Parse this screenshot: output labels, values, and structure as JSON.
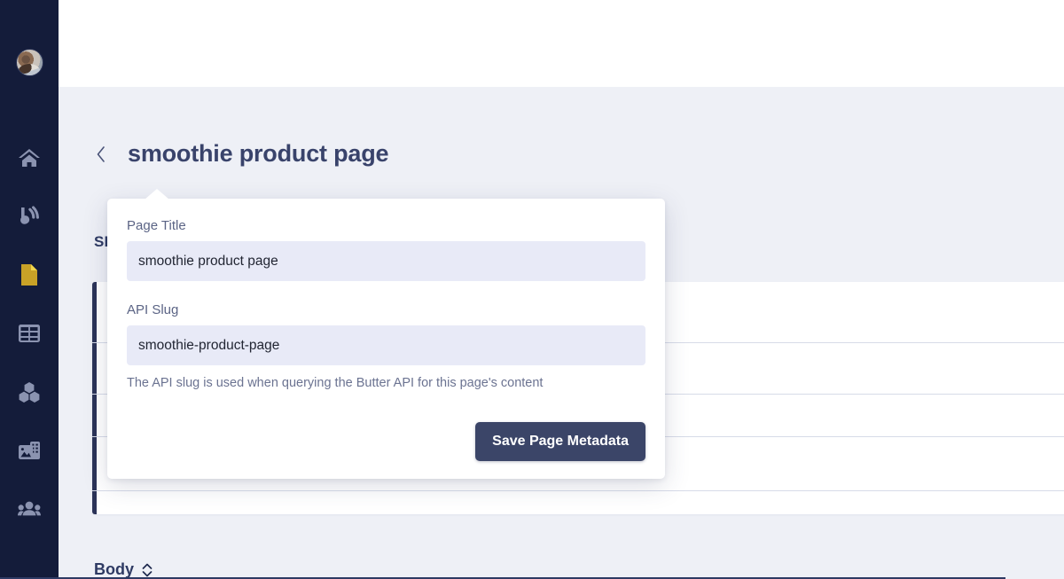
{
  "sidebar": {
    "avatar": {
      "name": "user-avatar",
      "alt": "User profile photo"
    },
    "items": [
      {
        "icon": "home-icon",
        "label": "Home",
        "active": false
      },
      {
        "icon": "blog-icon",
        "label": "Blog",
        "active": false
      },
      {
        "icon": "pages-icon",
        "label": "Pages",
        "active": true
      },
      {
        "icon": "collections-table-icon",
        "label": "Collections",
        "active": false
      },
      {
        "icon": "components-blocks-icon",
        "label": "Components",
        "active": false
      },
      {
        "icon": "media-image-icon",
        "label": "Media",
        "active": false
      },
      {
        "icon": "users-group-icon",
        "label": "Users",
        "active": false
      }
    ]
  },
  "header": {
    "back_icon": "chevron-left-icon",
    "title": "smoothie product page"
  },
  "sections": {
    "seo_heading": "SEO",
    "body_heading": "Body",
    "body_sort_icon": "sort-chevrons-icon"
  },
  "popup": {
    "title_field": {
      "label": "Page Title",
      "value": "smoothie product page",
      "placeholder": "Page Title"
    },
    "slug_field": {
      "label": "API Slug",
      "value": "smoothie-product-page",
      "placeholder": "API Slug"
    },
    "help_text": "The API slug is used when querying the Butter API for this page's content",
    "save_label": "Save Page Metadata"
  },
  "colors": {
    "sidebar_bg": "#141c3a",
    "accent_active": "#c9a227",
    "button_bg": "#3b4568",
    "input_bg": "#e8eaf7",
    "page_bg": "#eef0f6",
    "text_dark": "#39436b"
  }
}
